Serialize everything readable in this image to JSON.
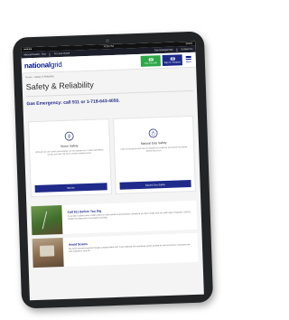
{
  "statusbar": {
    "carrier": "●●●●● ",
    "time": "4:20 PM",
    "battery": "100%"
  },
  "utility": {
    "region": "Massachusetts · Gas",
    "region_sub": "Change region",
    "my_account": "For your Home",
    "emergencies": "Gas Emergencies",
    "contact": "Contact Us"
  },
  "header": {
    "logo_part1": "national",
    "logo_part2": "grid",
    "pay_label": "Pay Your Bill",
    "signin_label": "Sign In / Register",
    "menu_label": "Menu"
  },
  "breadcrumb": {
    "home": "Home",
    "current": "Safety & Reliability"
  },
  "page": {
    "title": "Safety & Reliability",
    "emergency": "Gas Emergency: call 911 or 1-718-643-4050."
  },
  "cards": [
    {
      "title": "Storm Safety",
      "desc": "Although we can't predict the weather, we can prepare for it. Keep safe before, during, and after the worst weather-related events.",
      "button": "Storms"
    },
    {
      "title": "Natural Gas Safety",
      "desc": "Learn to recognize and react to dangerous conditions and prevent accidents before they occur.",
      "button": "Natural Gas Safety"
    }
  ],
  "strips": [
    {
      "title": "Call 811 Before You Dig",
      "text": "If you plan to plant a tree, install a fence or other outdoor improvements, call before you dig to make sure you steer clear of hazards. Call 811 at least two days prior to excavation activities."
    },
    {
      "title": "Avoid Scams",
      "text": "We never demand payment through a prepaid debit card. Every National Grid employee carries a photo ID card, and all our contractors are also required to carry ID."
    }
  ]
}
